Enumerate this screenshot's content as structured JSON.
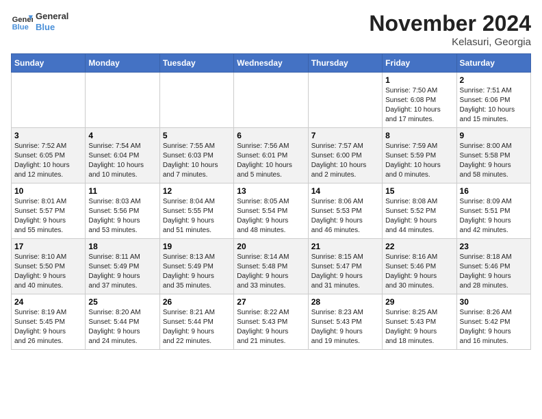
{
  "header": {
    "logo_line1": "General",
    "logo_line2": "Blue",
    "title": "November 2024",
    "subtitle": "Kelasuri, Georgia"
  },
  "weekdays": [
    "Sunday",
    "Monday",
    "Tuesday",
    "Wednesday",
    "Thursday",
    "Friday",
    "Saturday"
  ],
  "weeks": [
    [
      {
        "day": "",
        "info": ""
      },
      {
        "day": "",
        "info": ""
      },
      {
        "day": "",
        "info": ""
      },
      {
        "day": "",
        "info": ""
      },
      {
        "day": "",
        "info": ""
      },
      {
        "day": "1",
        "info": "Sunrise: 7:50 AM\nSunset: 6:08 PM\nDaylight: 10 hours\nand 17 minutes."
      },
      {
        "day": "2",
        "info": "Sunrise: 7:51 AM\nSunset: 6:06 PM\nDaylight: 10 hours\nand 15 minutes."
      }
    ],
    [
      {
        "day": "3",
        "info": "Sunrise: 7:52 AM\nSunset: 6:05 PM\nDaylight: 10 hours\nand 12 minutes."
      },
      {
        "day": "4",
        "info": "Sunrise: 7:54 AM\nSunset: 6:04 PM\nDaylight: 10 hours\nand 10 minutes."
      },
      {
        "day": "5",
        "info": "Sunrise: 7:55 AM\nSunset: 6:03 PM\nDaylight: 10 hours\nand 7 minutes."
      },
      {
        "day": "6",
        "info": "Sunrise: 7:56 AM\nSunset: 6:01 PM\nDaylight: 10 hours\nand 5 minutes."
      },
      {
        "day": "7",
        "info": "Sunrise: 7:57 AM\nSunset: 6:00 PM\nDaylight: 10 hours\nand 2 minutes."
      },
      {
        "day": "8",
        "info": "Sunrise: 7:59 AM\nSunset: 5:59 PM\nDaylight: 10 hours\nand 0 minutes."
      },
      {
        "day": "9",
        "info": "Sunrise: 8:00 AM\nSunset: 5:58 PM\nDaylight: 9 hours\nand 58 minutes."
      }
    ],
    [
      {
        "day": "10",
        "info": "Sunrise: 8:01 AM\nSunset: 5:57 PM\nDaylight: 9 hours\nand 55 minutes."
      },
      {
        "day": "11",
        "info": "Sunrise: 8:03 AM\nSunset: 5:56 PM\nDaylight: 9 hours\nand 53 minutes."
      },
      {
        "day": "12",
        "info": "Sunrise: 8:04 AM\nSunset: 5:55 PM\nDaylight: 9 hours\nand 51 minutes."
      },
      {
        "day": "13",
        "info": "Sunrise: 8:05 AM\nSunset: 5:54 PM\nDaylight: 9 hours\nand 48 minutes."
      },
      {
        "day": "14",
        "info": "Sunrise: 8:06 AM\nSunset: 5:53 PM\nDaylight: 9 hours\nand 46 minutes."
      },
      {
        "day": "15",
        "info": "Sunrise: 8:08 AM\nSunset: 5:52 PM\nDaylight: 9 hours\nand 44 minutes."
      },
      {
        "day": "16",
        "info": "Sunrise: 8:09 AM\nSunset: 5:51 PM\nDaylight: 9 hours\nand 42 minutes."
      }
    ],
    [
      {
        "day": "17",
        "info": "Sunrise: 8:10 AM\nSunset: 5:50 PM\nDaylight: 9 hours\nand 40 minutes."
      },
      {
        "day": "18",
        "info": "Sunrise: 8:11 AM\nSunset: 5:49 PM\nDaylight: 9 hours\nand 37 minutes."
      },
      {
        "day": "19",
        "info": "Sunrise: 8:13 AM\nSunset: 5:49 PM\nDaylight: 9 hours\nand 35 minutes."
      },
      {
        "day": "20",
        "info": "Sunrise: 8:14 AM\nSunset: 5:48 PM\nDaylight: 9 hours\nand 33 minutes."
      },
      {
        "day": "21",
        "info": "Sunrise: 8:15 AM\nSunset: 5:47 PM\nDaylight: 9 hours\nand 31 minutes."
      },
      {
        "day": "22",
        "info": "Sunrise: 8:16 AM\nSunset: 5:46 PM\nDaylight: 9 hours\nand 30 minutes."
      },
      {
        "day": "23",
        "info": "Sunrise: 8:18 AM\nSunset: 5:46 PM\nDaylight: 9 hours\nand 28 minutes."
      }
    ],
    [
      {
        "day": "24",
        "info": "Sunrise: 8:19 AM\nSunset: 5:45 PM\nDaylight: 9 hours\nand 26 minutes."
      },
      {
        "day": "25",
        "info": "Sunrise: 8:20 AM\nSunset: 5:44 PM\nDaylight: 9 hours\nand 24 minutes."
      },
      {
        "day": "26",
        "info": "Sunrise: 8:21 AM\nSunset: 5:44 PM\nDaylight: 9 hours\nand 22 minutes."
      },
      {
        "day": "27",
        "info": "Sunrise: 8:22 AM\nSunset: 5:43 PM\nDaylight: 9 hours\nand 21 minutes."
      },
      {
        "day": "28",
        "info": "Sunrise: 8:23 AM\nSunset: 5:43 PM\nDaylight: 9 hours\nand 19 minutes."
      },
      {
        "day": "29",
        "info": "Sunrise: 8:25 AM\nSunset: 5:43 PM\nDaylight: 9 hours\nand 18 minutes."
      },
      {
        "day": "30",
        "info": "Sunrise: 8:26 AM\nSunset: 5:42 PM\nDaylight: 9 hours\nand 16 minutes."
      }
    ]
  ]
}
